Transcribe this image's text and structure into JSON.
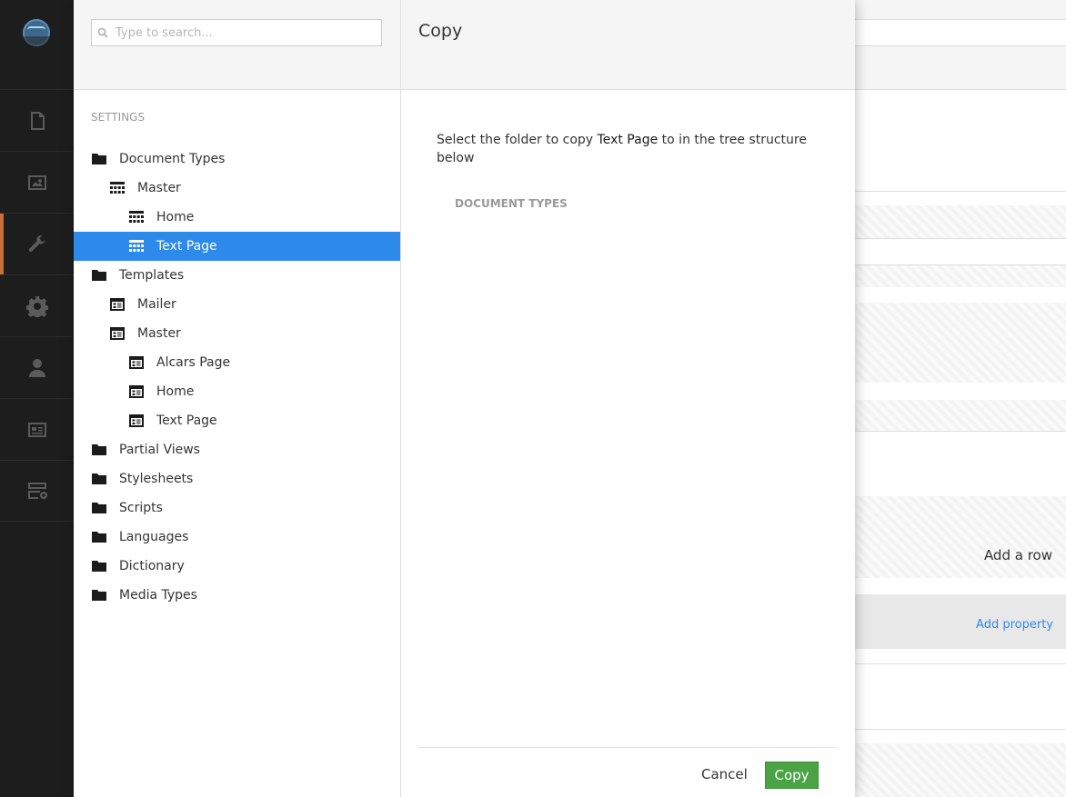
{
  "app_nav": {
    "sections": [
      {
        "name": "content",
        "icon": "document-icon",
        "active": false
      },
      {
        "name": "media",
        "icon": "image-icon",
        "active": false
      },
      {
        "name": "settings",
        "icon": "wrench-icon",
        "active": true
      },
      {
        "name": "developer",
        "icon": "gear-icon",
        "active": false
      },
      {
        "name": "users",
        "icon": "user-icon",
        "active": false
      },
      {
        "name": "members",
        "icon": "id-card-icon",
        "active": false
      },
      {
        "name": "forms",
        "icon": "form-icon",
        "active": false
      }
    ]
  },
  "tree_panel": {
    "search_placeholder": "Type to search...",
    "section_title": "SETTINGS",
    "nodes": [
      {
        "label": "Document Types",
        "icon": "folder-icon",
        "level": 0
      },
      {
        "label": "Master",
        "icon": "document-type-icon",
        "level": 1
      },
      {
        "label": "Home",
        "icon": "document-type-icon",
        "level": 2
      },
      {
        "label": "Text Page",
        "icon": "document-type-icon",
        "level": 2,
        "selected": true
      },
      {
        "label": "Templates",
        "icon": "folder-icon",
        "level": 0
      },
      {
        "label": "Mailer",
        "icon": "template-icon",
        "level": 1
      },
      {
        "label": "Master",
        "icon": "template-icon",
        "level": 1
      },
      {
        "label": "Alcars Page",
        "icon": "template-icon",
        "level": 2
      },
      {
        "label": "Home",
        "icon": "template-icon",
        "level": 2
      },
      {
        "label": "Text Page",
        "icon": "template-icon",
        "level": 2
      },
      {
        "label": "Partial Views",
        "icon": "folder-icon",
        "level": 0
      },
      {
        "label": "Stylesheets",
        "icon": "folder-icon",
        "level": 0
      },
      {
        "label": "Scripts",
        "icon": "folder-icon",
        "level": 0
      },
      {
        "label": "Languages",
        "icon": "folder-icon",
        "level": 0
      },
      {
        "label": "Dictionary",
        "icon": "folder-icon",
        "level": 0
      },
      {
        "label": "Media Types",
        "icon": "folder-icon",
        "level": 0
      }
    ]
  },
  "copy_dialog": {
    "title": "Copy",
    "instruction_before": "Select the folder to copy ",
    "instruction_item": "Text Page",
    "instruction_after": " to in the tree structure below",
    "tree_root": "DOCUMENT TYPES",
    "cancel_label": "Cancel",
    "copy_label": "Copy"
  },
  "background_editor": {
    "add_row_label": "Add a row",
    "add_property_label": "Add property"
  },
  "colors": {
    "selected": "#2e8aea",
    "primary_button": "#4aa443",
    "active_section": "#c86d37",
    "nav_background": "#1d1d1d"
  }
}
